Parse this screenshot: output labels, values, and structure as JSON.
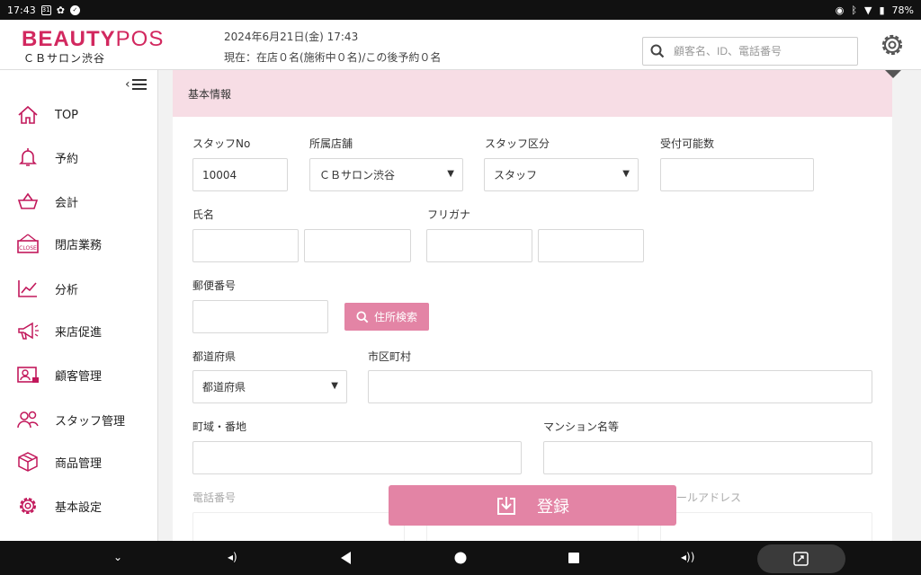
{
  "statusbar": {
    "time": "17:43",
    "cal": "31",
    "battery": "78%"
  },
  "header": {
    "brand_a": "BEAUTY",
    "brand_b": "POS",
    "store": "ＣＢサロン渋谷",
    "datetime": "2024年6月21日(金) 17:43",
    "status": "現在：在店０名(施術中０名)/この後予約０名",
    "search_placeholder": "顧客名、ID、電話番号"
  },
  "sidebar": {
    "items": [
      {
        "label": "TOP",
        "icon": "home-icon"
      },
      {
        "label": "予約",
        "icon": "bell-icon"
      },
      {
        "label": "会計",
        "icon": "basket-icon"
      },
      {
        "label": "閉店業務",
        "icon": "close-sign-icon"
      },
      {
        "label": "分析",
        "icon": "chart-icon"
      },
      {
        "label": "来店促進",
        "icon": "megaphone-icon"
      },
      {
        "label": "顧客管理",
        "icon": "customer-card-icon"
      },
      {
        "label": "スタッフ管理",
        "icon": "staff-icon"
      },
      {
        "label": "商品管理",
        "icon": "box-icon"
      },
      {
        "label": "基本設定",
        "icon": "gear-icon"
      }
    ]
  },
  "form": {
    "section_title": "基本情報",
    "staff_no_label": "スタッフNo",
    "staff_no_value": "10004",
    "store_label": "所属店舗",
    "store_value": "ＣＢサロン渋谷",
    "staff_type_label": "スタッフ区分",
    "staff_type_value": "スタッフ",
    "reception_label": "受付可能数",
    "name_label": "氏名",
    "kana_label": "フリガナ",
    "postal_label": "郵便番号",
    "address_search_label": "住所検索",
    "prefecture_label": "都道府県",
    "prefecture_value": "都道府県",
    "city_label": "市区町村",
    "street_label": "町域・番地",
    "building_label": "マンション名等",
    "phone_label": "電話番号",
    "email_label_partial": "ールアドレス"
  },
  "register_label": "登録"
}
